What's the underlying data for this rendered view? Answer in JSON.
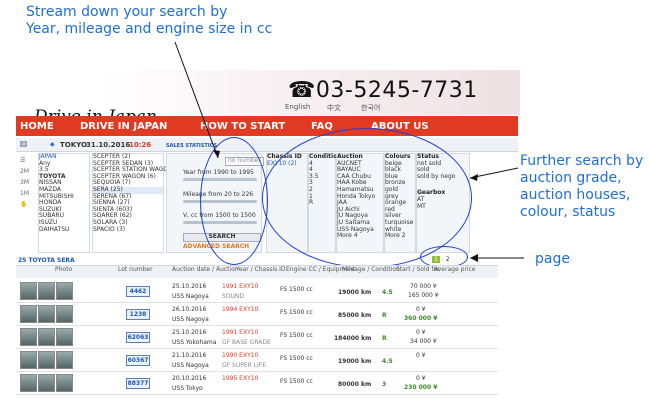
{
  "annotations": {
    "top": "Stream down your search by\nYear, mileage and engine size in cc",
    "right": "Further search by\nauction grade,\nauction houses,\ncolour, status",
    "page": "page"
  },
  "header": {
    "logo": "Drive in Japan",
    "phone": "03-5245-7731",
    "lang_en": "English",
    "lang_zh": "中文",
    "lang_ko": "한국어"
  },
  "nav": [
    "HOME",
    "DRIVE IN JAPAN",
    "HOW TO START",
    "FAQ",
    "ABOUT US"
  ],
  "crumb": {
    "location": "TOKYO",
    "date": "31.10.2016",
    "time": "10:26",
    "stats": "SALES STATISTICS"
  },
  "makes": [
    "JAPAN",
    "Any",
    "3.5",
    "TOYOTA",
    "NISSAN",
    "MAZDA",
    "MITSUBISHI",
    "HONDA",
    "SUZUKI",
    "SUBARU",
    "ISUZU",
    "DAIHATSU"
  ],
  "models": [
    "SCEPTER (2)",
    "SCEPTER SEDAN (3)",
    "SCEPTER STATION WAGON (2)",
    "SCEPTER WAGON (6)",
    "SEQUOIA (7)",
    "SERA (25)",
    "SERENA (67)",
    "SIENNA (27)",
    "SIENTA (603)",
    "SOARER (62)",
    "SOLARA (3)",
    "SPACIO (3)"
  ],
  "filters": {
    "no_number": "no number",
    "year": "Year from 1990 to 1995",
    "mileage": "Mileage from 20 to 226",
    "vcc": "V, cc from 1500 to 1500",
    "search": "SEARCH",
    "advanced": "ADVANCED SEARCH"
  },
  "chassis": {
    "title": "Chassis ID",
    "items": [
      "EXY10 (2)"
    ]
  },
  "condition": {
    "title": "Condition",
    "items": [
      "4",
      "4",
      "3.5",
      "3",
      "2",
      "1",
      "R"
    ]
  },
  "auction": {
    "title": "Auction",
    "items": [
      "AUCNET",
      "BAYAUC",
      "CAA Chubu",
      "HAA Kobe",
      "Hamamatsu",
      "Honda Tokyo",
      "JAA",
      "JU Aichi",
      "JU Nagoya",
      "JU Saitama",
      "USS Nagoya",
      "More 4"
    ]
  },
  "colours": {
    "title": "Colours",
    "items": [
      "beige",
      "black",
      "blue",
      "bronze",
      "gold",
      "grey",
      "orange",
      "red",
      "silver",
      "turquoise",
      "white",
      "More 2"
    ]
  },
  "status": {
    "title": "Status",
    "items": [
      "not sold",
      "sold",
      "sold by nego"
    ],
    "gearbox": "Gearbox",
    "gb_items": [
      "AT",
      "MT"
    ]
  },
  "results": {
    "title": "25 TOYOTA SERA",
    "page_current": "1",
    "page_next": "2"
  },
  "columns": [
    "Photo",
    "Lot number",
    "Auction date / Auction",
    "Year / Chassis ID",
    "Engine CC / Equipment",
    "Mileage / Condition",
    "Start / Sold for",
    "Average price"
  ],
  "rows": [
    {
      "lot": "4462",
      "date": "25.10.2016",
      "auction": "USS Nagoya",
      "year": "1991 EXY10",
      "eq": "SOUND",
      "cc": "FS 1500 cc",
      "mileage": "19000 km",
      "grade": "4.5",
      "start": "70 000 ¥",
      "sold": "165 000 ¥",
      "avg": ""
    },
    {
      "lot": "1238",
      "date": "26.10.2016",
      "auction": "USS Nagoya",
      "year": "1994 EXY10",
      "eq": "",
      "cc": "FS 1500 cc",
      "mileage": "85000 km",
      "grade": "R",
      "start": "0 ¥",
      "sold": "360 000 ¥",
      "avg": ""
    },
    {
      "lot": "62063",
      "date": "25.10.2016",
      "auction": "USS Yokohama",
      "year": "1991 EXY10",
      "eq": "GF BASE GRADE",
      "cc": "FS 1500 cc",
      "mileage": "184000 km",
      "grade": "R",
      "start": "0 ¥",
      "sold": "34 000 ¥",
      "avg": ""
    },
    {
      "lot": "60367",
      "date": "21.10.2016",
      "auction": "USS Nagoya",
      "year": "1990 EXY10",
      "eq": "GF SUPER LIFE",
      "cc": "FS 1500 cc",
      "mileage": "19000 km",
      "grade": "4.5",
      "start": "0 ¥",
      "sold": "",
      "avg": ""
    },
    {
      "lot": "88377",
      "date": "20.10.2016",
      "auction": "USS Tokyo",
      "year": "1995 EXY10",
      "eq": "",
      "cc": "FS 1500 cc",
      "mileage": "80000 km",
      "grade": "3",
      "start": "0 ¥",
      "sold": "230 000 ¥",
      "avg": ""
    }
  ]
}
